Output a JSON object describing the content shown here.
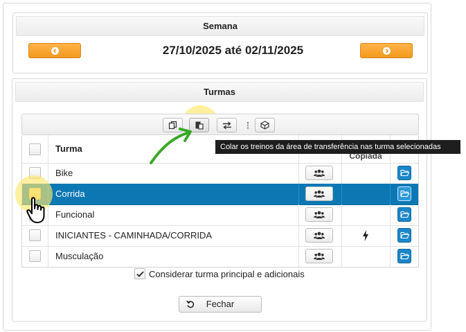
{
  "week": {
    "header": "Semana",
    "range": "27/10/2025 até 02/11/2025"
  },
  "classes": {
    "header": "Turmas",
    "columns": {
      "name": "Turma",
      "copied": "Copiada"
    },
    "rows": [
      {
        "name": "Bike",
        "selected": false,
        "copied": false
      },
      {
        "name": "Corrida",
        "selected": true,
        "copied": false
      },
      {
        "name": "Funcional",
        "selected": false,
        "copied": false
      },
      {
        "name": "INICIANTES - CAMINHADA/CORRIDA",
        "selected": false,
        "copied": true
      },
      {
        "name": "Musculação",
        "selected": false,
        "copied": false
      }
    ]
  },
  "tooltip": "Colar os treinos da área de transferência nas turma selecionadas",
  "consider_label": "Considerar turma principal e adicionais",
  "close_label": "Fechar",
  "colors": {
    "orange": "#f39a1f",
    "selected_row": "#0b78b4",
    "open_button": "#1b86c8",
    "highlight": "#ffe86e",
    "arrow": "#3aa829"
  }
}
